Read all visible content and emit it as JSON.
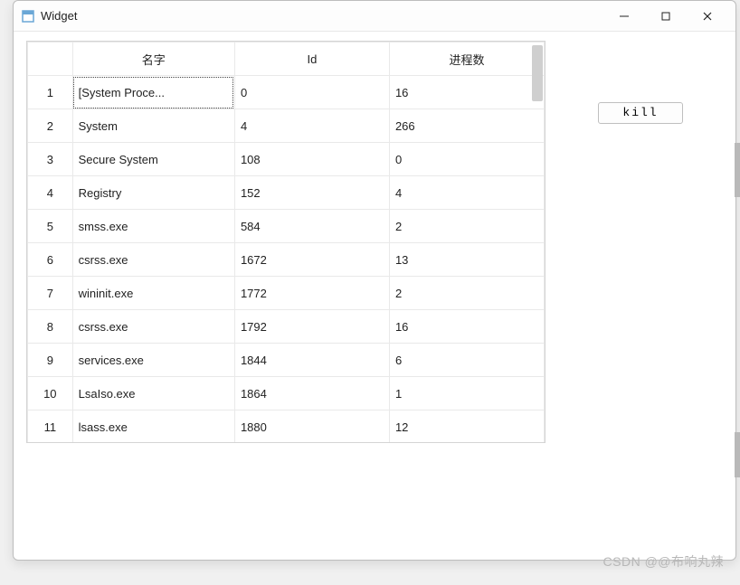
{
  "window": {
    "title": "Widget"
  },
  "buttons": {
    "kill": "kill"
  },
  "table": {
    "headers": {
      "name": "名字",
      "id": "Id",
      "threads": "进程数"
    },
    "rows": [
      {
        "n": "1",
        "name": "[System Proce...",
        "id": "0",
        "threads": "16"
      },
      {
        "n": "2",
        "name": "System",
        "id": "4",
        "threads": "266"
      },
      {
        "n": "3",
        "name": "Secure System",
        "id": "108",
        "threads": "0"
      },
      {
        "n": "4",
        "name": "Registry",
        "id": "152",
        "threads": "4"
      },
      {
        "n": "5",
        "name": "smss.exe",
        "id": "584",
        "threads": "2"
      },
      {
        "n": "6",
        "name": "csrss.exe",
        "id": "1672",
        "threads": "13"
      },
      {
        "n": "7",
        "name": "wininit.exe",
        "id": "1772",
        "threads": "2"
      },
      {
        "n": "8",
        "name": "csrss.exe",
        "id": "1792",
        "threads": "16"
      },
      {
        "n": "9",
        "name": "services.exe",
        "id": "1844",
        "threads": "6"
      },
      {
        "n": "10",
        "name": "LsaIso.exe",
        "id": "1864",
        "threads": "1"
      },
      {
        "n": "11",
        "name": "lsass.exe",
        "id": "1880",
        "threads": "12"
      }
    ]
  },
  "watermark": "CSDN @@布响丸辣"
}
